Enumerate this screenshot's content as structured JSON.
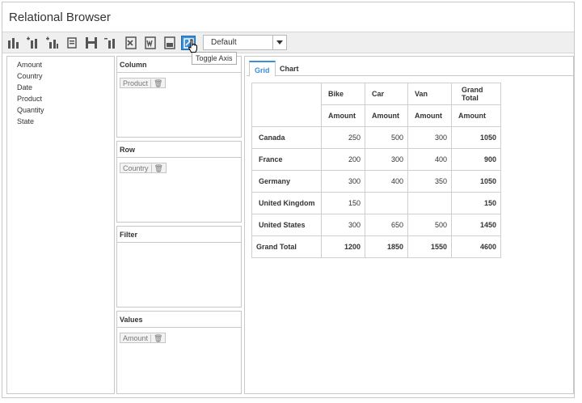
{
  "app": {
    "title": "Relational Browser"
  },
  "toolbar": {
    "buttons": [
      {
        "name": "new-report-icon"
      },
      {
        "name": "add-report-icon"
      },
      {
        "name": "add-chart-icon"
      },
      {
        "name": "rename-report-icon"
      },
      {
        "name": "save-icon"
      },
      {
        "name": "remove-report-icon"
      },
      {
        "name": "export-excel-icon"
      },
      {
        "name": "export-word-icon"
      },
      {
        "name": "export-pdf-icon"
      },
      {
        "name": "toggle-axis-icon"
      }
    ],
    "report_select": {
      "value": "Default"
    },
    "tooltip": "Toggle Axis",
    "accent": "#3a8fd8"
  },
  "field_list": {
    "items": [
      "Amount",
      "Country",
      "Date",
      "Product",
      "Quantity",
      "State"
    ]
  },
  "axes": {
    "column": {
      "label": "Column",
      "chip": "Product"
    },
    "row": {
      "label": "Row",
      "chip": "Country"
    },
    "filter": {
      "label": "Filter"
    },
    "values": {
      "label": "Values",
      "chip": "Amount"
    }
  },
  "tabs": {
    "grid": "Grid",
    "chart": "Chart"
  },
  "grid": {
    "columns": [
      "Bike",
      "Car",
      "Van",
      "Grand Total"
    ],
    "measure": "Amount",
    "rows": [
      {
        "label": "Canada",
        "values": [
          "250",
          "500",
          "300",
          "1050"
        ]
      },
      {
        "label": "France",
        "values": [
          "200",
          "300",
          "400",
          "900"
        ]
      },
      {
        "label": "Germany",
        "values": [
          "300",
          "400",
          "350",
          "1050"
        ]
      },
      {
        "label": "United Kingdom",
        "values": [
          "150",
          "",
          "",
          "150"
        ]
      },
      {
        "label": "United States",
        "values": [
          "300",
          "650",
          "500",
          "1450"
        ]
      },
      {
        "label": "Grand Total",
        "values": [
          "1200",
          "1850",
          "1550",
          "4600"
        ]
      }
    ]
  }
}
